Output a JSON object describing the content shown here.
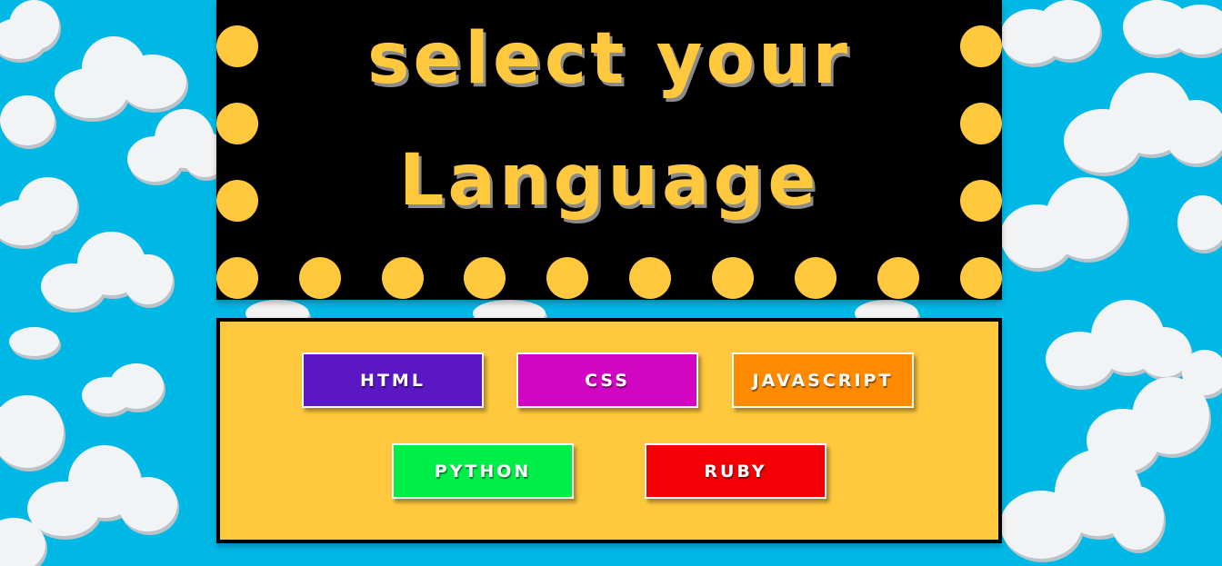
{
  "header": {
    "title_line1": "select your",
    "title_line2": "Language"
  },
  "buttons": [
    {
      "label": "HTML",
      "color": "#5b17c4"
    },
    {
      "label": "CSS",
      "color": "#d205c2"
    },
    {
      "label": "JAVASCRIPT",
      "color": "#ff8a00"
    },
    {
      "label": "PYTHON",
      "color": "#00ee48"
    },
    {
      "label": "RUBY",
      "color": "#f20006"
    }
  ],
  "colors": {
    "sky": "#00b8e6",
    "cloud": "#f2f3f4",
    "marquee_bg": "#000000",
    "bulb": "#ffc83d",
    "panel_bg": "#ffc83d",
    "panel_border": "#000000"
  }
}
